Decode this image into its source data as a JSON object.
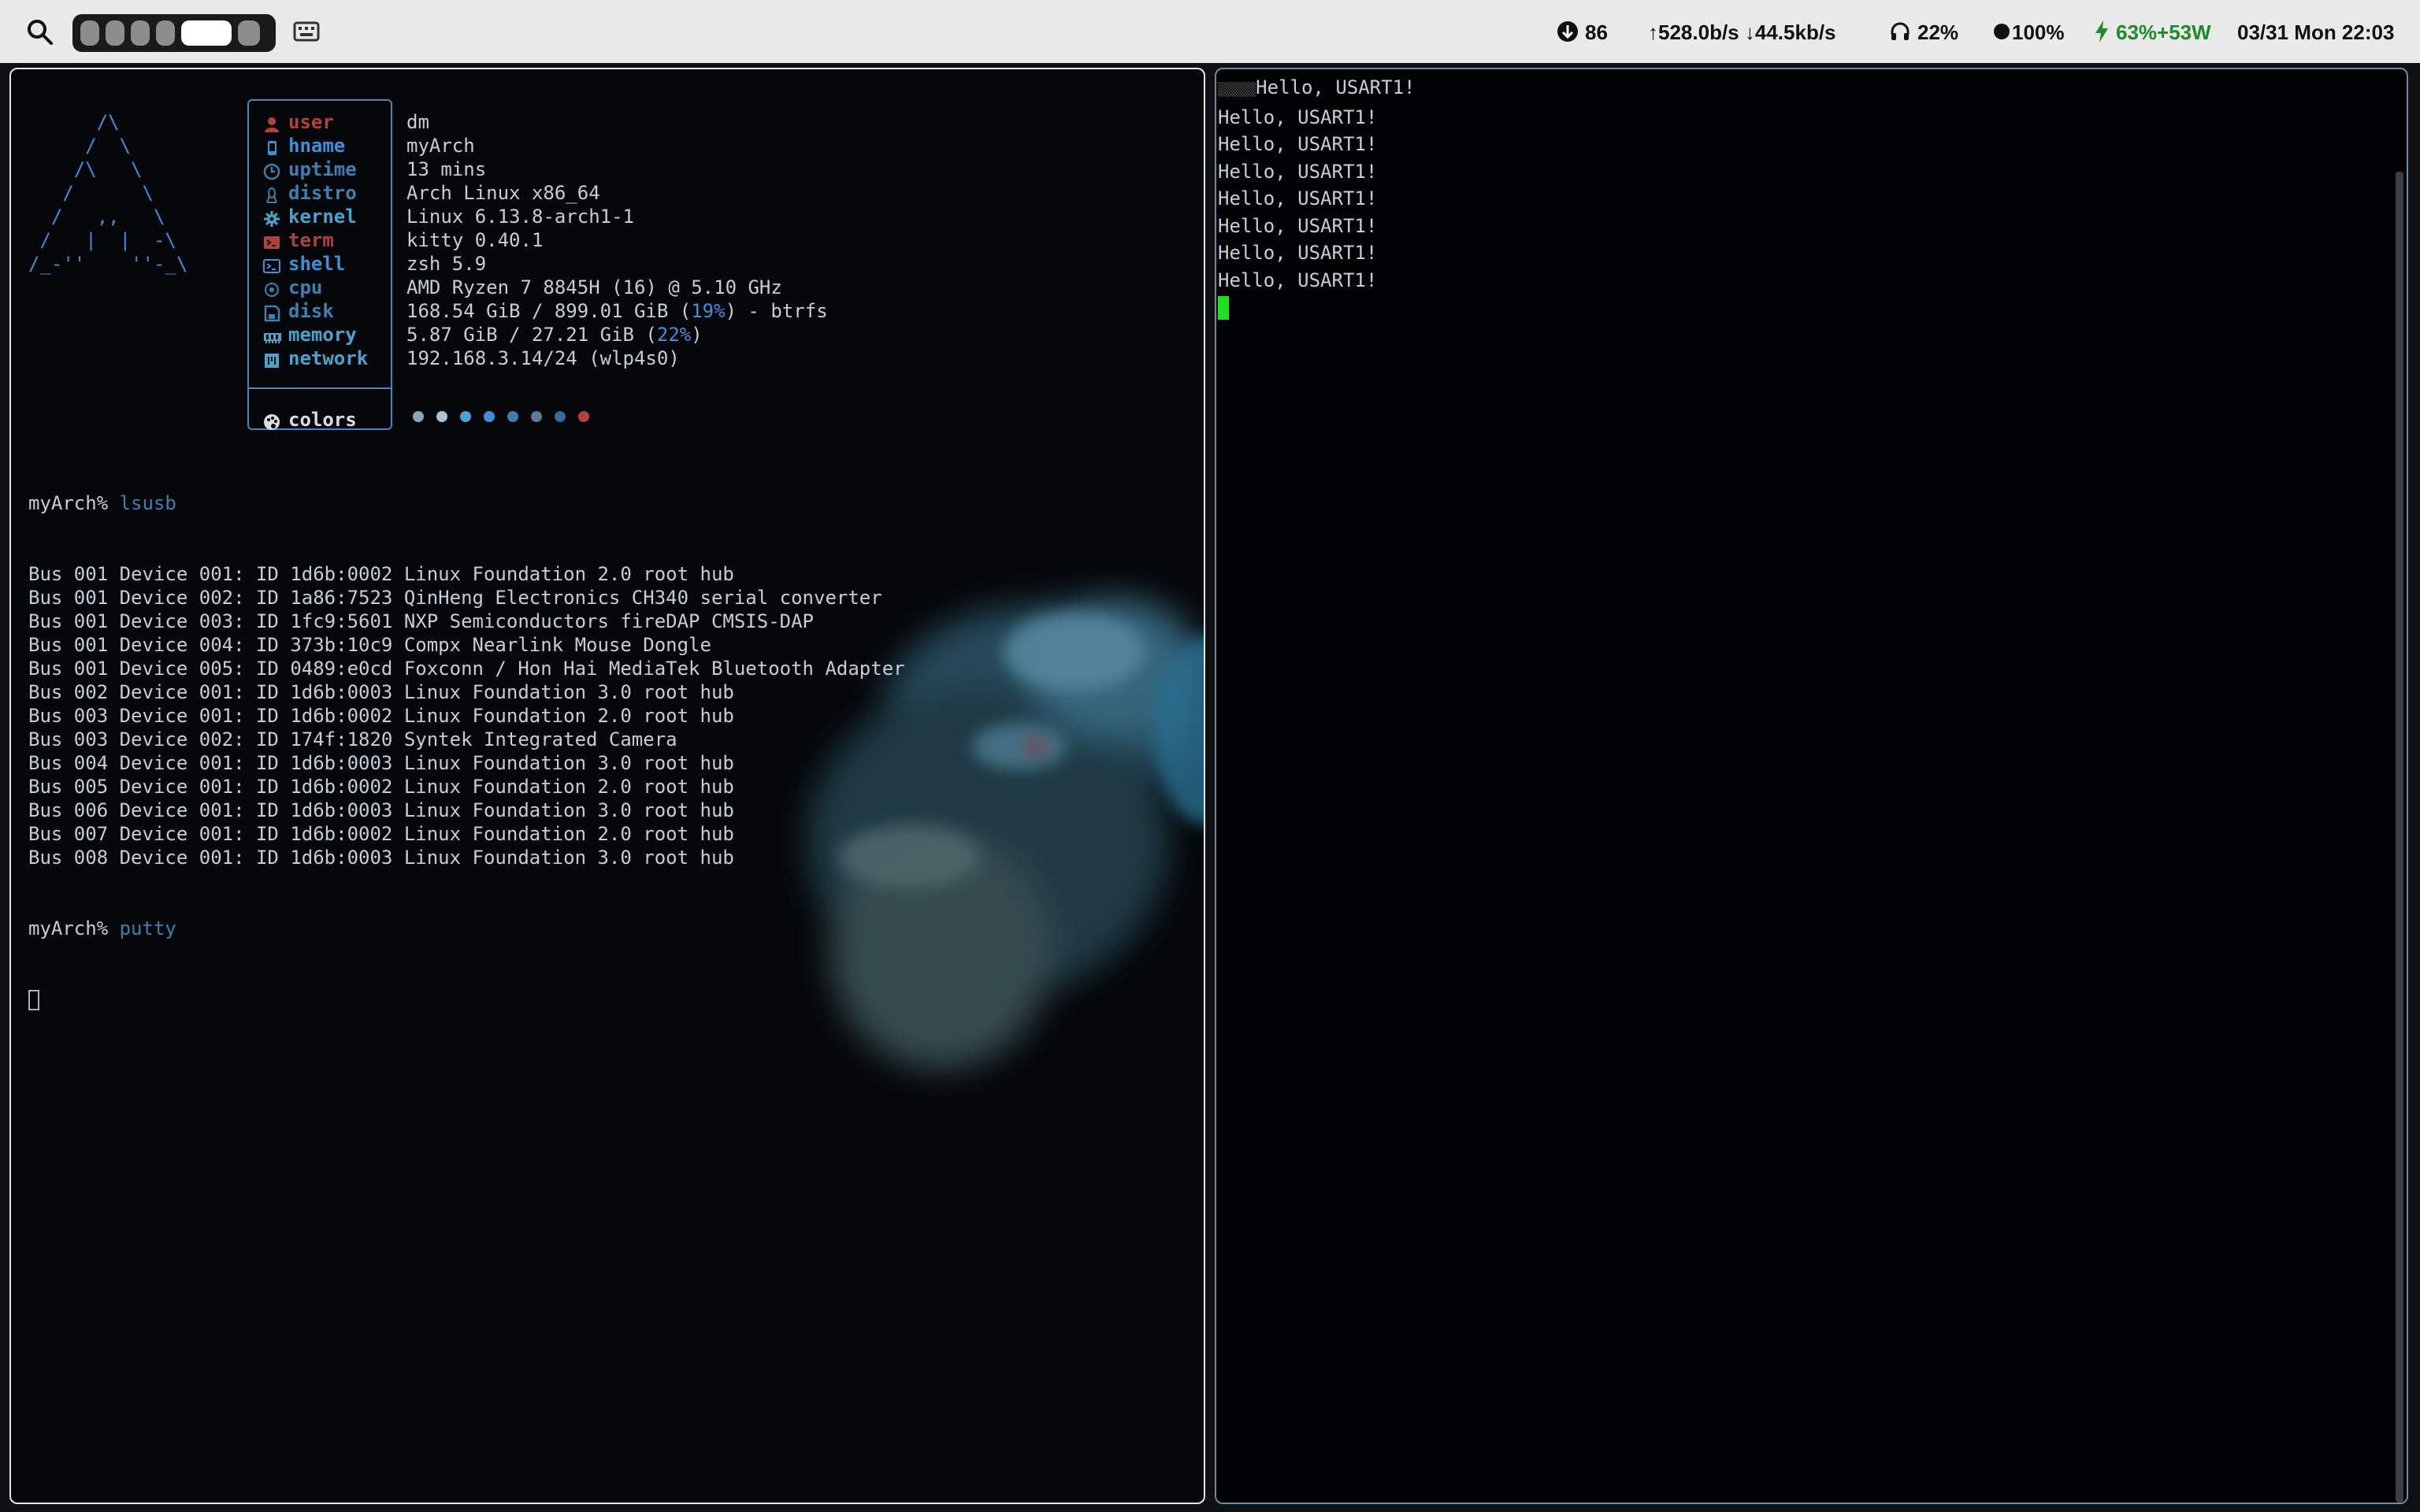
{
  "topbar": {
    "workspaces": [
      {
        "index": 1,
        "active": false
      },
      {
        "index": 2,
        "active": false
      },
      {
        "index": 3,
        "active": false
      },
      {
        "index": 4,
        "active": true
      },
      {
        "index": 5,
        "active": false
      }
    ],
    "updates": "86",
    "net_up": "528.0b/s",
    "net_down": "44.5kb/s",
    "volume": "22%",
    "brightness": "100%",
    "battery": "63%+53W",
    "datetime": "03/31 Mon 22:03",
    "colors": {
      "battery": "#1f8a2a",
      "bar_bg": "#e9e9ea"
    }
  },
  "fetch": {
    "logo_lines": [
      "      /\\",
      "     /  \\",
      "    /\\   \\",
      "   /      \\",
      "  /   ,,   \\",
      " /   |  |  -\\",
      "/_-''    ''-_\\"
    ],
    "rows": [
      {
        "icon": "user-icon",
        "label": "user",
        "value": "dm",
        "color": "#b0413e"
      },
      {
        "icon": "phone-icon",
        "label": "hname",
        "value": "myArch",
        "color": "#3c8fd8"
      },
      {
        "icon": "clock-icon",
        "label": "uptime",
        "value": "13 mins",
        "color": "#3f7fb0"
      },
      {
        "icon": "tux-icon",
        "label": "distro",
        "value": "Arch Linux x86_64",
        "color": "#3f7fb0"
      },
      {
        "icon": "gear-icon",
        "label": "kernel",
        "value": "Linux 6.13.8-arch1-1",
        "color": "#4aa3cf"
      },
      {
        "icon": "terminal-icon",
        "label": "term",
        "value": "kitty 0.40.1",
        "color": "#b0413e"
      },
      {
        "icon": "shell-icon",
        "label": "shell",
        "value": "zsh 5.9",
        "color": "#3c8fd8"
      },
      {
        "icon": "cpu-icon",
        "label": "cpu",
        "value": "AMD Ryzen 7 8845H (16) @ 5.10 GHz",
        "color": "#3f7fb0"
      },
      {
        "icon": "disk-icon",
        "label": "disk",
        "value_pre": "168.54 GiB / 899.01 GiB (",
        "value_pct": "19%",
        "value_post": ") - btrfs",
        "color": "#3f7fb0"
      },
      {
        "icon": "memory-icon",
        "label": "memory",
        "value_pre": "5.87 GiB / 27.21 GiB (",
        "value_pct": "22%",
        "value_post": ")",
        "color": "#4aa3cf"
      },
      {
        "icon": "network-icon",
        "label": "network",
        "value": "192.168.3.14/24 (wlp4s0)",
        "color": "#4aa3cf"
      }
    ],
    "colors_label": "colors",
    "color_dots": [
      "#8aa7bb",
      "#a9c3d3",
      "#4aa3cf",
      "#3c8fd8",
      "#3f7fb0",
      "#5f7a90",
      "#3a6a9a",
      "#b0413e"
    ]
  },
  "terminal": {
    "prompt_host": "myArch%",
    "command1": "lsusb",
    "usb_lines": [
      "Bus 001 Device 001: ID 1d6b:0002 Linux Foundation 2.0 root hub",
      "Bus 001 Device 002: ID 1a86:7523 QinHeng Electronics CH340 serial converter",
      "Bus 001 Device 003: ID 1fc9:5601 NXP Semiconductors fireDAP CMSIS-DAP",
      "Bus 001 Device 004: ID 373b:10c9 Compx Nearlink Mouse Dongle",
      "Bus 001 Device 005: ID 0489:e0cd Foxconn / Hon Hai MediaTek Bluetooth Adapter",
      "Bus 002 Device 001: ID 1d6b:0003 Linux Foundation 3.0 root hub",
      "Bus 003 Device 001: ID 1d6b:0002 Linux Foundation 2.0 root hub",
      "Bus 003 Device 002: ID 174f:1820 Syntek Integrated Camera",
      "Bus 004 Device 001: ID 1d6b:0003 Linux Foundation 3.0 root hub",
      "Bus 005 Device 001: ID 1d6b:0002 Linux Foundation 2.0 root hub",
      "Bus 006 Device 001: ID 1d6b:0003 Linux Foundation 3.0 root hub",
      "Bus 007 Device 001: ID 1d6b:0002 Linux Foundation 2.0 root hub",
      "Bus 008 Device 001: ID 1d6b:0003 Linux Foundation 3.0 root hub"
    ],
    "command2": "putty"
  },
  "serial": {
    "lines": [
      "Hello, USART1!",
      "Hello, USART1!",
      "Hello, USART1!",
      "Hello, USART1!",
      "Hello, USART1!",
      "Hello, USART1!",
      "Hello, USART1!",
      "Hello, USART1!"
    ]
  }
}
